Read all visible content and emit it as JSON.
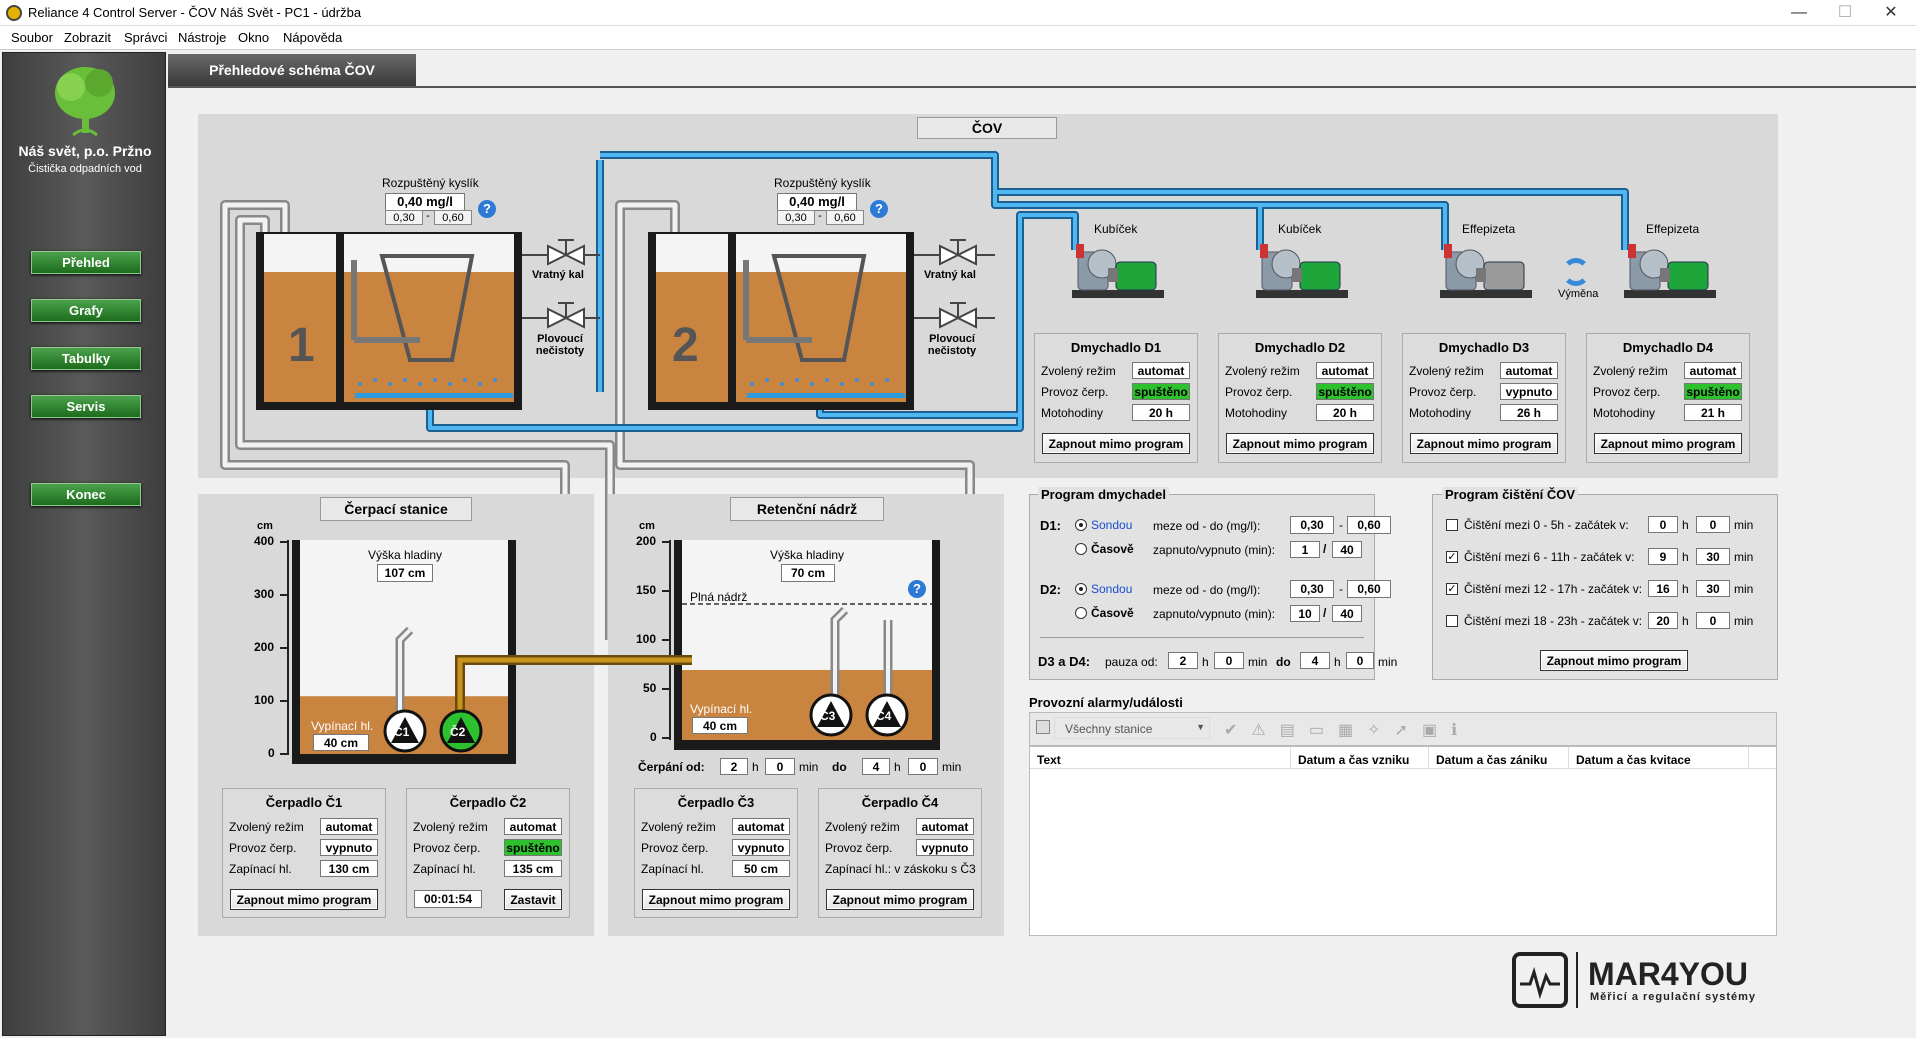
{
  "window": {
    "title": "Reliance 4 Control Server - ČOV Náš Svět - PC1 - údržba",
    "min": "—",
    "max": "☐",
    "close": "✕"
  },
  "menu": [
    "Soubor",
    "Zobrazit",
    "Správci",
    "Nástroje",
    "Okno",
    "Nápověda"
  ],
  "sidebar": {
    "org": "Náš svět, p.o. Pržno",
    "subtitle": "Čistička odpadních vod",
    "logo_icon": "tree-icon",
    "nav": [
      "Přehled",
      "Grafy",
      "Tabulky",
      "Servis",
      "Konec"
    ]
  },
  "tab": "Přehledové schéma ČOV",
  "cov": {
    "caption": "ČOV",
    "tank1": {
      "number": "1",
      "oxygen_label": "Rozpuštěný kyslík",
      "oxygen": "0,40 mg/l",
      "min": "0,30",
      "max": "0,60",
      "sep": "-"
    },
    "tank2": {
      "number": "2",
      "oxygen_label": "Rozpuštěný kyslík",
      "oxygen": "0,40 mg/l",
      "min": "0,30",
      "max": "0,60",
      "sep": "-"
    },
    "valve_return": "Vratný kal",
    "valve_float": "Plovoucí nečistoty",
    "blower_names": [
      "Kubíček",
      "Kubíček",
      "Effepizeta",
      "Effepizeta"
    ],
    "swap": "Výměna",
    "blowers": [
      {
        "title": "Dmychadlo D1",
        "mode": "automat",
        "state": "spuštěno",
        "hours": "20 h",
        "on": true
      },
      {
        "title": "Dmychadlo D2",
        "mode": "automat",
        "state": "spuštěno",
        "hours": "20 h",
        "on": true
      },
      {
        "title": "Dmychadlo D3",
        "mode": "automat",
        "state": "vypnuto",
        "hours": "26 h",
        "on": false
      },
      {
        "title": "Dmychadlo D4",
        "mode": "automat",
        "state": "spuštěno",
        "hours": "21 h",
        "on": true
      }
    ],
    "blower_labels": {
      "mode": "Zvolený režim",
      "state": "Provoz čerp.",
      "hours": "Motohodiny",
      "button": "Zapnout mimo program"
    }
  },
  "pump_station": {
    "caption": "Čerpací stanice",
    "unit": "cm",
    "ticks": [
      "400",
      "300",
      "200",
      "100",
      "0"
    ],
    "level_label": "Výška hladiny",
    "level": "107 cm",
    "level_fraction": 0.27,
    "off_label": "Vypínací hl.",
    "off_value": "40 cm",
    "pumps": [
      "Č1",
      "Č2"
    ],
    "cards": [
      {
        "title": "Čerpadlo Č1",
        "mode": "automat",
        "state": "vypnuto",
        "third_label": "Zapínací hl.",
        "third": "130 cm",
        "button": "Zapnout mimo program"
      },
      {
        "title": "Čerpadlo Č2",
        "mode": "automat",
        "state": "spuštěno",
        "third_label": "Zapínací hl.",
        "third": "135 cm",
        "timer": "00:01:54",
        "button": "Zastavit"
      }
    ]
  },
  "retention": {
    "caption": "Retenční nádrž",
    "unit": "cm",
    "ticks": [
      "200",
      "150",
      "100",
      "50",
      "0"
    ],
    "level_label": "Výška hladiny",
    "level": "70 cm",
    "level_fraction": 0.35,
    "full": "Plná nádrž",
    "off_label": "Vypínací hl.",
    "off_value": "40 cm",
    "pumps": [
      "Č3",
      "Č4"
    ],
    "schedule": {
      "label": "Čerpání od:",
      "from_h": "2",
      "from_m": "0",
      "to": "do",
      "to_h": "4",
      "to_m": "0",
      "h": "h",
      "min": "min"
    },
    "cards": [
      {
        "title": "Čerpadlo Č3",
        "mode": "automat",
        "state": "vypnuto",
        "third_label": "Zapínací hl.",
        "third": "50 cm",
        "button": "Zapnout mimo program"
      },
      {
        "title": "Čerpadlo Č4",
        "mode": "automat",
        "state": "vypnuto",
        "third_label": "Zapínací hl.: v záskoku s Č3",
        "button": "Zapnout mimo program"
      }
    ]
  },
  "card_labels": {
    "mode": "Zvolený režim",
    "state": "Provoz čerp."
  },
  "program_blowers": {
    "title": "Program dmychadel",
    "d1": {
      "label": "D1:",
      "probe": "Sondou",
      "time": "Časově",
      "range_label": "meze od - do (mg/l):",
      "from": "0,30",
      "to": "0,60",
      "onoff_label": "zapnuto/vypnuto (min):",
      "on": "1",
      "off": "40"
    },
    "d2": {
      "label": "D2:",
      "probe": "Sondou",
      "time": "Časově",
      "range_label": "meze od - do (mg/l):",
      "from": "0,30",
      "to": "0,60",
      "onoff_label": "zapnuto/vypnuto (min):",
      "on": "10",
      "off": "40"
    },
    "d3d4": {
      "label": "D3 a D4:",
      "pause": "pauza od:",
      "from_h": "2",
      "from_m": "0",
      "to": "do",
      "to_h": "4",
      "to_m": "0",
      "h": "h",
      "min": "min"
    },
    "dash": "-",
    "slash": "/"
  },
  "program_cleaning": {
    "title": "Program čištění ČOV",
    "rows": [
      {
        "label": "Čištění mezi 0 - 5h - začátek v:",
        "checked": false,
        "h": "0",
        "m": "0"
      },
      {
        "label": "Čištění mezi 6 - 11h - začátek v:",
        "checked": true,
        "h": "9",
        "m": "30"
      },
      {
        "label": "Čištění mezi 12 - 17h - začátek v:",
        "checked": true,
        "h": "16",
        "m": "30"
      },
      {
        "label": "Čištění mezi 18 - 23h - začátek v:",
        "checked": false,
        "h": "20",
        "m": "0"
      }
    ],
    "h": "h",
    "min": "min",
    "button": "Zapnout mimo program"
  },
  "alarms": {
    "title": "Provozní alarmy/události",
    "filter": "Všechny stanice",
    "columns": [
      "Text",
      "Datum a čas vzniku",
      "Datum a čas zániku",
      "Datum a čas kvitace"
    ]
  },
  "brand": {
    "name": "MAR4YOU",
    "tagline": "Měřicí a regulační systémy"
  },
  "colors": {
    "sludge": "#c98540",
    "pipe_blue": "#2d9be0",
    "pipe_brown": "#b07c1a",
    "green": "#2ec12e",
    "panel": "#d9d9d9"
  }
}
